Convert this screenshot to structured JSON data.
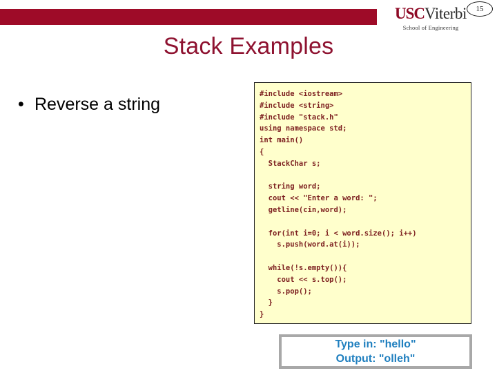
{
  "header": {
    "bar_color": "#9e0b28",
    "logo": {
      "usc": "USC",
      "viterbi": "Viterbi",
      "subtitle": "School of Engineering"
    },
    "page_number": "15"
  },
  "title": "Stack Examples",
  "bullets": [
    {
      "marker": "•",
      "text": "Reverse a string"
    }
  ],
  "code": {
    "background_color": "#ffffcc",
    "text_color": "#7d2020",
    "lines": [
      "#include <iostream>",
      "#include <string>",
      "#include \"stack.h\"",
      "using namespace std;",
      "int main()",
      "{",
      "  StackChar s;",
      "",
      "  string word;",
      "  cout << \"Enter a word: \";",
      "  getline(cin,word);",
      "",
      "  for(int i=0; i < word.size(); i++)",
      "    s.push(word.at(i));",
      "",
      "  while(!s.empty()){",
      "    cout << s.top();",
      "    s.pop();",
      "  }",
      "}"
    ]
  },
  "output": {
    "text_color": "#1F7FBF",
    "lines": [
      "Type in: \"hello\"",
      "Output: \"olleh\""
    ]
  }
}
